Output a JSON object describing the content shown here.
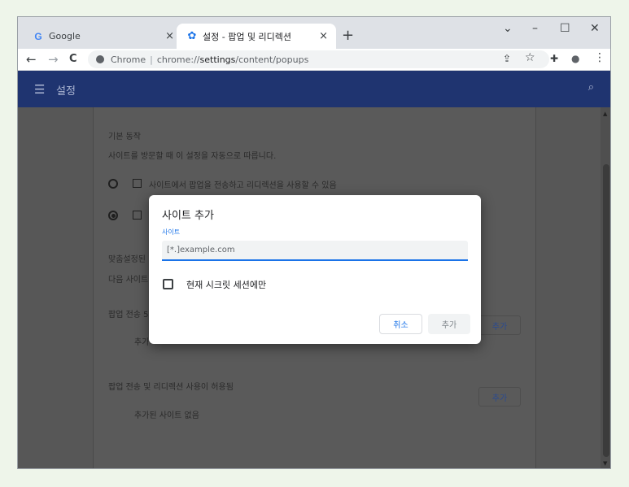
{
  "tabs": [
    {
      "label": "Google",
      "favicon": "google-g-icon"
    },
    {
      "label": "설정 - 팝업 및 리디렉션",
      "favicon": "gear-icon"
    }
  ],
  "tab_close_glyph": "×",
  "new_tab_glyph": "+",
  "window_controls": {
    "dropdown": "⌄",
    "minimize": "–",
    "maximize": "☐",
    "close": "✕"
  },
  "nav": {
    "back": "←",
    "forward": "→",
    "reload": "C"
  },
  "omnibox": {
    "scheme_label": "Chrome",
    "separator": "|",
    "url_prefix": "chrome://",
    "url_host": "settings",
    "url_path": "/content/popups"
  },
  "toolbar_icons": {
    "share": "⇪",
    "bookmark": "☆",
    "extensions": "✚",
    "profile": "●",
    "menu": "⋮"
  },
  "header": {
    "menu_glyph": "☰",
    "title": "설정",
    "search_glyph": "⌕"
  },
  "settings": {
    "default_behavior_title": "기본 동작",
    "default_behavior_desc": "사이트를 방문할 때 이 설정을 자동으로 따릅니다.",
    "option_allow": "사이트에서 팝업을 전송하고 리디렉션을 사용할 수 있음",
    "custom_partial": "맞춤설정된",
    "custom_desc_partial": "다음 사이트",
    "block_partial": "팝업 전송 5",
    "block_empty_partial": "추가",
    "block_add": "추가",
    "allowed_title": "팝업 전송 및 리디렉션 사용이 허용됨",
    "allowed_add": "추가",
    "allowed_empty": "추가된 사이트 없음"
  },
  "dialog": {
    "title": "사이트 추가",
    "field_label": "사이트",
    "field_placeholder": "[*.]example.com",
    "checkbox_label": "현재 시크릿 세션에만",
    "checkbox_checked": false,
    "cancel": "취소",
    "add": "추가"
  },
  "colors": {
    "accent": "#1a73e8",
    "header": "#1f3470"
  }
}
